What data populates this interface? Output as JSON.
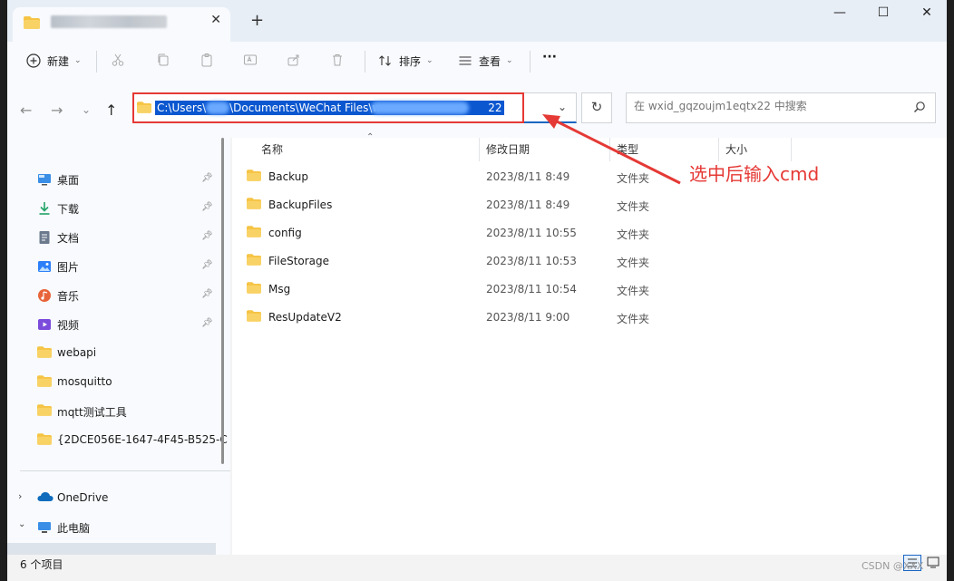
{
  "tab": {
    "close": "✕"
  },
  "window_controls": {
    "minimize": "—",
    "maximize": "☐",
    "close": "✕"
  },
  "new_tab": "+",
  "toolbar": {
    "new_label": "新建",
    "sort_label": "排序",
    "view_label": "查看",
    "more_label": "···"
  },
  "address": {
    "path_left": "C:\\Users\\",
    "path_mid": "\\Documents\\WeChat Files\\w",
    "path_end": "22"
  },
  "search": {
    "placeholder": "在 wxid_gqzoujm1eqtx22 中搜索"
  },
  "sidebar": {
    "pinned": [
      {
        "label": "桌面",
        "icon": "desktop-icon"
      },
      {
        "label": "下载",
        "icon": "download-icon"
      },
      {
        "label": "文档",
        "icon": "document-icon"
      },
      {
        "label": "图片",
        "icon": "pictures-icon"
      },
      {
        "label": "音乐",
        "icon": "music-icon"
      },
      {
        "label": "视频",
        "icon": "video-icon"
      }
    ],
    "folders": [
      {
        "label": "webapi"
      },
      {
        "label": "mosquitto"
      },
      {
        "label": "mqtt测试工具"
      },
      {
        "label": "{2DCE056E-1647-4F45-B525-C"
      }
    ],
    "onedrive": "OneDrive",
    "thispc": "此电脑"
  },
  "columns": {
    "name": "名称",
    "date": "修改日期",
    "type": "类型",
    "size": "大小"
  },
  "files": [
    {
      "name": "Backup",
      "date": "2023/8/11 8:49",
      "type": "文件夹"
    },
    {
      "name": "BackupFiles",
      "date": "2023/8/11 8:49",
      "type": "文件夹"
    },
    {
      "name": "config",
      "date": "2023/8/11 10:55",
      "type": "文件夹"
    },
    {
      "name": "FileStorage",
      "date": "2023/8/11 10:53",
      "type": "文件夹"
    },
    {
      "name": "Msg",
      "date": "2023/8/11 10:54",
      "type": "文件夹"
    },
    {
      "name": "ResUpdateV2",
      "date": "2023/8/11 9:00",
      "type": "文件夹"
    }
  ],
  "annotation": "选中后输入cmd",
  "status": {
    "count": "6 个项目"
  },
  "watermark": "CSDN @XXX",
  "colors": {
    "folder": "#f6c445",
    "annotation": "#e53935",
    "selection": "#0b57d0"
  }
}
